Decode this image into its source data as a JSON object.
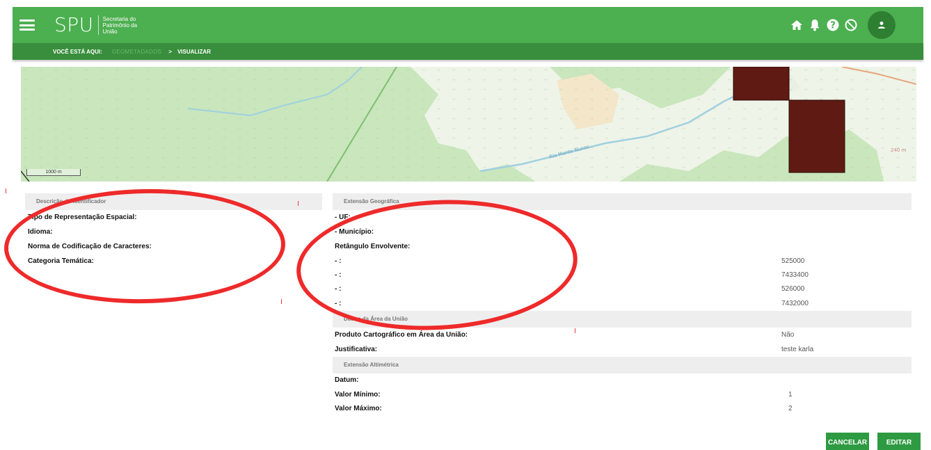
{
  "header": {
    "logo_mark": "SPU",
    "logo_text_line1": "Secretaria do",
    "logo_text_line2": "Patrimônio da",
    "logo_text_line3": "União",
    "icons": [
      "menu-icon",
      "home-icon",
      "bell-icon",
      "help-icon",
      "block-icon",
      "user-icon"
    ],
    "color": "#4caf50"
  },
  "breadcrumb": {
    "label": "VOCÊ ESTÁ AQUI:",
    "link": "GEOMETADADOS",
    "separator": ">",
    "current": "VISUALIZAR"
  },
  "map": {
    "scale_label": "1000 m",
    "river_label": "Rio Monte Nunes",
    "elevation_label": "240 m"
  },
  "left_panel": {
    "header": "Descrição do Identificador",
    "fields": [
      {
        "label": "Tipo de Representação Espacial:"
      },
      {
        "label": "Idioma:"
      },
      {
        "label": "Norma de Codificação de Caracteres:"
      },
      {
        "label": "Categoria Temática:"
      }
    ]
  },
  "right_panel": {
    "extent_header": "Extensão Geográfica",
    "uf_label": "- UF:",
    "municipio_label": "- Município:",
    "bbox_label": "Retângulo Envolvente:",
    "bbox_rows": [
      {
        "label": "- :",
        "value": "525000"
      },
      {
        "label": "- :",
        "value": "7433400"
      },
      {
        "label": "- :",
        "value": "526000"
      },
      {
        "label": "- :",
        "value": "7432000"
      }
    ],
    "union_header": "Dados da Área da União",
    "union_rows": [
      {
        "label": "Produto Cartográfico em Área da União:",
        "value": "Não"
      },
      {
        "label": "Justificativa:",
        "value": "teste karla"
      }
    ],
    "altimetric_header": "Extensão Altimétrica",
    "altimetric_rows": [
      {
        "label": "Datum:",
        "value": ""
      },
      {
        "label": "Valor Mínimo:",
        "value": "1"
      },
      {
        "label": "Valor Máximo:",
        "value": "2"
      }
    ]
  },
  "actions": {
    "cancel_label": "CANCELAR",
    "edit_label": "EDITAR",
    "button_color": "#2e9a42"
  },
  "annotation_color": "#ee2a2a"
}
